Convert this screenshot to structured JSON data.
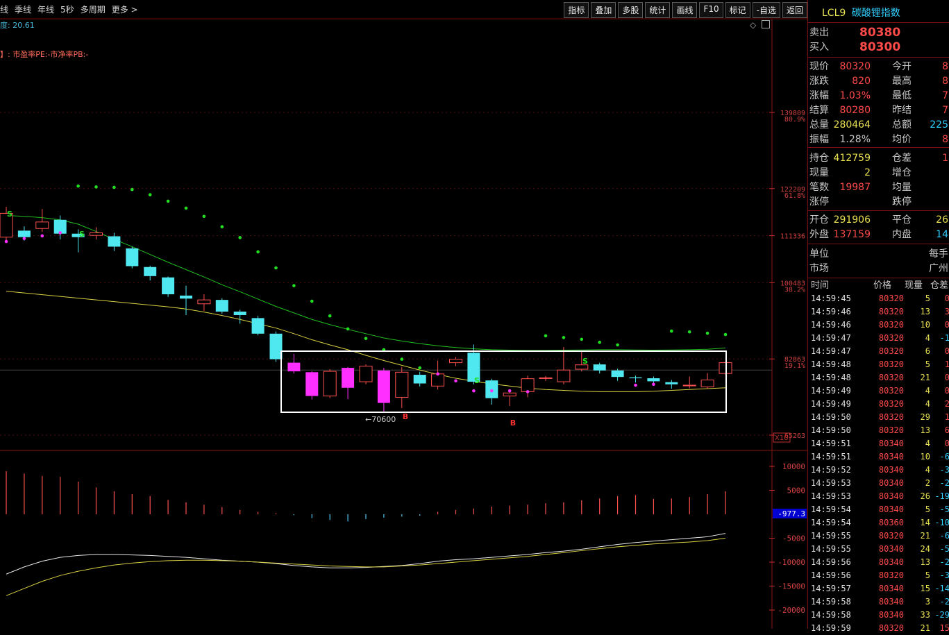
{
  "toolbar": {
    "left_items": [
      "线",
      "季线",
      "年线",
      "5秒",
      "多周期",
      "更多 >"
    ],
    "right_buttons": [
      "指标",
      "叠加",
      "多股",
      "统计",
      "画线",
      "F10",
      "标记",
      "-自选",
      "返回"
    ]
  },
  "chart_info": {
    "line1": "度: 20.61",
    "line2": "】: 市盈率PE:-市净率PB:-"
  },
  "price_axis": {
    "labels": [
      "139809",
      "122209",
      "111336",
      "100483",
      "82863",
      "65263"
    ],
    "pcts": [
      "80.9%",
      "61.8%",
      "38.2%",
      "19.1%"
    ],
    "zoom_tag": "X10"
  },
  "annotations": {
    "low_label": "←70600",
    "s_marker": "S",
    "b_marker": "B"
  },
  "macd_axis": {
    "labels": [
      "10000",
      "5000",
      "-5000",
      "-10000",
      "-15000",
      "-20000"
    ],
    "current_value": "-977.3"
  },
  "chart_data": {
    "type": "candlestick",
    "ohlc": [
      {
        "o": 111000,
        "c": 116500,
        "h": 118000,
        "l": 110000
      },
      {
        "o": 112500,
        "c": 111000,
        "h": 113500,
        "l": 110200
      },
      {
        "o": 113000,
        "c": 114500,
        "h": 117500,
        "l": 112200
      },
      {
        "o": 115000,
        "c": 111800,
        "h": 116000,
        "l": 110500
      },
      {
        "o": 111800,
        "c": 111000,
        "h": 112800,
        "l": 107500
      },
      {
        "o": 111400,
        "c": 112000,
        "h": 113300,
        "l": 110500
      },
      {
        "o": 111200,
        "c": 108800,
        "h": 112000,
        "l": 107800
      },
      {
        "o": 108400,
        "c": 104300,
        "h": 108800,
        "l": 103800
      },
      {
        "o": 104100,
        "c": 102000,
        "h": 104400,
        "l": 101000
      },
      {
        "o": 101700,
        "c": 97800,
        "h": 101900,
        "l": 97200
      },
      {
        "o": 97500,
        "c": 96800,
        "h": 99800,
        "l": 93000
      },
      {
        "o": 95600,
        "c": 96500,
        "h": 97800,
        "l": 94000
      },
      {
        "o": 96500,
        "c": 93800,
        "h": 96900,
        "l": 93300
      },
      {
        "o": 93800,
        "c": 93000,
        "h": 94200,
        "l": 91000
      },
      {
        "o": 92300,
        "c": 88700,
        "h": 92800,
        "l": 88300
      },
      {
        "o": 88700,
        "c": 82800,
        "h": 89200,
        "l": 82200
      },
      {
        "o": 82000,
        "c": 80000,
        "h": 84000,
        "l": 79500
      },
      {
        "o": 79800,
        "c": 74300,
        "h": 80000,
        "l": 73500
      },
      {
        "o": 74300,
        "c": 80000,
        "h": 80500,
        "l": 73800
      },
      {
        "o": 80800,
        "c": 76200,
        "h": 81000,
        "l": 73600
      },
      {
        "o": 77600,
        "c": 81200,
        "h": 81600,
        "l": 77000
      },
      {
        "o": 80200,
        "c": 72700,
        "h": 80800,
        "l": 70600
      },
      {
        "o": 74000,
        "c": 79800,
        "h": 81000,
        "l": 71500
      },
      {
        "o": 79200,
        "c": 77200,
        "h": 79900,
        "l": 76500
      },
      {
        "o": 76600,
        "c": 79400,
        "h": 82500,
        "l": 75800
      },
      {
        "o": 82000,
        "c": 82800,
        "h": 83300,
        "l": 81200
      },
      {
        "o": 84300,
        "c": 77600,
        "h": 86200,
        "l": 77000
      },
      {
        "o": 77900,
        "c": 73800,
        "h": 78300,
        "l": 72300
      },
      {
        "o": 74300,
        "c": 75000,
        "h": 75500,
        "l": 72000
      },
      {
        "o": 75300,
        "c": 78300,
        "h": 79000,
        "l": 74000
      },
      {
        "o": 78400,
        "c": 78500,
        "h": 78900,
        "l": 77800
      },
      {
        "o": 77600,
        "c": 80300,
        "h": 85600,
        "l": 77000
      },
      {
        "o": 80500,
        "c": 81500,
        "h": 84800,
        "l": 80000
      },
      {
        "o": 81600,
        "c": 80200,
        "h": 82000,
        "l": 79500
      },
      {
        "o": 80200,
        "c": 78700,
        "h": 80600,
        "l": 77800
      },
      {
        "o": 78600,
        "c": 78400,
        "h": 79000,
        "l": 77400
      },
      {
        "o": 78400,
        "c": 77700,
        "h": 78800,
        "l": 76900
      },
      {
        "o": 77500,
        "c": 77000,
        "h": 78000,
        "l": 76000
      },
      {
        "o": 76800,
        "c": 76800,
        "h": 78800,
        "l": 76100
      },
      {
        "o": 76400,
        "c": 78000,
        "h": 79600,
        "l": 76000
      },
      {
        "o": 79500,
        "c": 82000,
        "h": 82200,
        "l": 79200
      }
    ],
    "ma_fast": [
      116000,
      115800,
      115500,
      115000,
      114000,
      112300,
      110500,
      108800,
      107000,
      105200,
      103500,
      101800,
      100000,
      98400,
      96700,
      95000,
      93500,
      92000,
      90800,
      89700,
      88700,
      87700,
      87000,
      86400,
      85900,
      85500,
      85200,
      85000,
      84900,
      84850,
      84850,
      84900,
      84950,
      85000,
      85000,
      84950,
      84900,
      84950,
      85000,
      85100,
      85400
    ],
    "ma_slow": [
      98500,
      98100,
      97700,
      97300,
      96900,
      96500,
      96100,
      95700,
      95300,
      94900,
      94400,
      93700,
      92900,
      92000,
      91000,
      90000,
      88700,
      87300,
      86100,
      85000,
      83700,
      82500,
      81400,
      80300,
      79300,
      78400,
      77700,
      77100,
      76600,
      76100,
      75800,
      75600,
      75400,
      75300,
      75300,
      75300,
      75400,
      75600,
      75800,
      76000,
      76200
    ],
    "sar": [
      {
        "i": 0,
        "v": 110000
      },
      {
        "i": 1,
        "v": 110700
      },
      {
        "i": 2,
        "v": 111300
      },
      {
        "i": 3,
        "v": 112000
      },
      {
        "i": 4,
        "v": 122800
      },
      {
        "i": 5,
        "v": 122600
      },
      {
        "i": 6,
        "v": 122500
      },
      {
        "i": 7,
        "v": 122000
      },
      {
        "i": 8,
        "v": 120800
      },
      {
        "i": 9,
        "v": 119300
      },
      {
        "i": 10,
        "v": 117700
      },
      {
        "i": 11,
        "v": 115800
      },
      {
        "i": 12,
        "v": 113400
      },
      {
        "i": 13,
        "v": 110900
      },
      {
        "i": 14,
        "v": 107600
      },
      {
        "i": 15,
        "v": 103900
      },
      {
        "i": 16,
        "v": 99800
      },
      {
        "i": 17,
        "v": 96200
      },
      {
        "i": 18,
        "v": 92800
      },
      {
        "i": 19,
        "v": 89800
      },
      {
        "i": 20,
        "v": 87600
      },
      {
        "i": 21,
        "v": 85000
      },
      {
        "i": 22,
        "v": 82800
      },
      {
        "i": 23,
        "v": 80800
      },
      {
        "i": 24,
        "v": 79400
      },
      {
        "i": 25,
        "v": 77800
      },
      {
        "i": 26,
        "v": 75500
      },
      {
        "i": 27,
        "v": 75500
      },
      {
        "i": 28,
        "v": 75500
      },
      {
        "i": 29,
        "v": 75300
      },
      {
        "i": 30,
        "v": 88200
      },
      {
        "i": 31,
        "v": 87800
      },
      {
        "i": 32,
        "v": 87400
      },
      {
        "i": 33,
        "v": 86700
      },
      {
        "i": 34,
        "v": 86100
      },
      {
        "i": 35,
        "v": 76800
      },
      {
        "i": 36,
        "v": 77000
      },
      {
        "i": 37,
        "v": 89300
      },
      {
        "i": 38,
        "v": 89100
      },
      {
        "i": 39,
        "v": 88800
      },
      {
        "i": 40,
        "v": 88500
      }
    ],
    "volume_macd_bars": [
      9000,
      8500,
      8000,
      7800,
      6800,
      5600,
      4800,
      4200,
      3800,
      3000,
      2500,
      2000,
      1500,
      900,
      500,
      200,
      -200,
      -800,
      -1200,
      -1500,
      -1000,
      -700,
      -500,
      -300,
      500,
      900,
      1200,
      1600,
      1800,
      2000,
      2300,
      2500,
      2900,
      3300,
      3800,
      4000,
      3200,
      3300,
      3600,
      4200,
      4800
    ],
    "macd_line": [
      -12500,
      -11000,
      -9800,
      -9000,
      -8600,
      -8400,
      -8400,
      -8500,
      -8600,
      -8800,
      -9000,
      -9300,
      -9600,
      -9800,
      -10000,
      -10300,
      -10700,
      -11000,
      -11200,
      -11200,
      -11100,
      -10900,
      -10700,
      -10300,
      -9800,
      -9500,
      -9300,
      -9000,
      -8700,
      -8400,
      -8000,
      -7700,
      -7300,
      -6800,
      -6300,
      -5900,
      -5600,
      -5300,
      -5000,
      -4700,
      -4000
    ],
    "signal_line": [
      -17000,
      -15500,
      -14000,
      -12800,
      -11900,
      -11200,
      -10600,
      -10200,
      -9900,
      -9700,
      -9600,
      -9600,
      -9700,
      -9800,
      -10000,
      -10200,
      -10400,
      -10600,
      -10800,
      -10900,
      -11000,
      -11000,
      -10800,
      -10600,
      -10300,
      -10000,
      -9700,
      -9400,
      -9100,
      -8800,
      -8400,
      -8000,
      -7600,
      -7200,
      -6800,
      -6500,
      -6200,
      -6000,
      -5800,
      -5500,
      -5000
    ]
  },
  "quote": {
    "code": "LCL9",
    "name": "碳酸锂指数",
    "sell_label": "卖出",
    "sell": "80380",
    "buy_label": "买入",
    "buy": "80300",
    "rows": [
      {
        "l1": "现价",
        "v1": "80320",
        "l2": "今开",
        "v2": "8"
      },
      {
        "l1": "涨跌",
        "v1": "820",
        "l2": "最高",
        "v2": "8"
      },
      {
        "l1": "涨幅",
        "v1": "1.03%",
        "l2": "最低",
        "v2": "7"
      },
      {
        "l1": "结算",
        "v1": "80280",
        "l2": "昨结",
        "v2": "7"
      },
      {
        "l1": "总量",
        "v1": "280464",
        "l2": "总额",
        "v2": "225"
      },
      {
        "l1": "振幅",
        "v1": "1.28%",
        "l2": "均价",
        "v2": "8"
      }
    ],
    "rows2": [
      {
        "l1": "持仓",
        "v1": "412759",
        "l2": "仓差",
        "v2": "1"
      },
      {
        "l1": "现量",
        "v1": "2",
        "l2": "增仓",
        "v2": ""
      },
      {
        "l1": "笔数",
        "v1": "19987",
        "l2": "均量",
        "v2": ""
      },
      {
        "l1": "涨停",
        "v1": "",
        "l2": "跌停",
        "v2": ""
      }
    ],
    "rows3": [
      {
        "l1": "开仓",
        "v1": "291906",
        "l2": "平仓",
        "v2": "26"
      },
      {
        "l1": "外盘",
        "v1": "137159",
        "l2": "内盘",
        "v2": "14"
      }
    ],
    "unit_label": "单位",
    "unit_value": "每手",
    "market_label": "市场",
    "market_value": "广州"
  },
  "ticks": {
    "headers": [
      "时间",
      "价格",
      "现量",
      "仓差"
    ],
    "rows": [
      [
        "14:59:45",
        "80320",
        "5",
        "0"
      ],
      [
        "14:59:46",
        "80320",
        "13",
        "3"
      ],
      [
        "14:59:46",
        "80320",
        "10",
        "0"
      ],
      [
        "14:59:47",
        "80320",
        "4",
        "-1"
      ],
      [
        "14:59:47",
        "80320",
        "6",
        "0"
      ],
      [
        "14:59:48",
        "80320",
        "5",
        "1"
      ],
      [
        "14:59:48",
        "80320",
        "21",
        "0"
      ],
      [
        "14:59:49",
        "80320",
        "4",
        "0"
      ],
      [
        "14:59:49",
        "80320",
        "4",
        "2"
      ],
      [
        "14:59:50",
        "80320",
        "29",
        "1"
      ],
      [
        "14:59:50",
        "80320",
        "13",
        "6"
      ],
      [
        "14:59:51",
        "80340",
        "4",
        "0"
      ],
      [
        "14:59:51",
        "80340",
        "10",
        "-6"
      ],
      [
        "14:59:52",
        "80340",
        "4",
        "-3"
      ],
      [
        "14:59:53",
        "80340",
        "2",
        "-2"
      ],
      [
        "14:59:53",
        "80340",
        "26",
        "-19"
      ],
      [
        "14:59:54",
        "80340",
        "5",
        "-5"
      ],
      [
        "14:59:54",
        "80360",
        "14",
        "-10"
      ],
      [
        "14:59:55",
        "80320",
        "21",
        "-6"
      ],
      [
        "14:59:55",
        "80340",
        "24",
        "-5"
      ],
      [
        "14:59:56",
        "80340",
        "13",
        "-2"
      ],
      [
        "14:59:56",
        "80320",
        "5",
        "-3"
      ],
      [
        "14:59:57",
        "80340",
        "15",
        "-14"
      ],
      [
        "14:59:58",
        "80340",
        "3",
        "-2"
      ],
      [
        "14:59:58",
        "80340",
        "33",
        "-29"
      ],
      [
        "14:59:59",
        "80320",
        "21",
        "15"
      ]
    ]
  }
}
